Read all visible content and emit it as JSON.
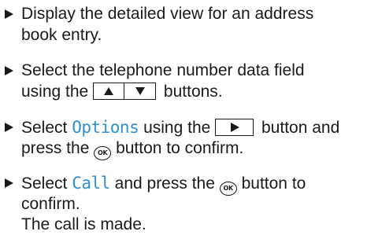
{
  "steps": [
    {
      "lines": [
        "Display the detailed view for an address",
        "book entry."
      ]
    },
    {
      "line1": "Select the telephone number data field",
      "line2_before": "using the",
      "line2_after": "buttons.",
      "buttons": [
        "up-arrow",
        "down-arrow"
      ]
    },
    {
      "line1_before": "Select",
      "line1_highlight": "Options",
      "line1_mid": "using the",
      "line1_after": "button and",
      "line2_before": "press the",
      "line2_button": "OK",
      "line2_after": "button to confirm."
    },
    {
      "line1_before": "Select",
      "line1_highlight": "Call",
      "line1_mid": "and press the",
      "line1_button": "OK",
      "line1_after": "button to",
      "line2": "confirm.",
      "result": "The call is made."
    }
  ],
  "colors": {
    "text": "#1a1a1a",
    "highlight": "#2f8fd2",
    "background": "#ffffff"
  }
}
